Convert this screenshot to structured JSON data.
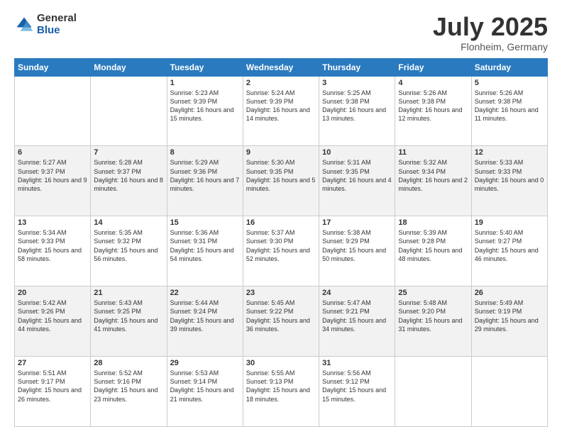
{
  "logo": {
    "general": "General",
    "blue": "Blue"
  },
  "title": "July 2025",
  "location": "Flonheim, Germany",
  "days_of_week": [
    "Sunday",
    "Monday",
    "Tuesday",
    "Wednesday",
    "Thursday",
    "Friday",
    "Saturday"
  ],
  "weeks": [
    [
      {
        "day": "",
        "sunrise": "",
        "sunset": "",
        "daylight": ""
      },
      {
        "day": "",
        "sunrise": "",
        "sunset": "",
        "daylight": ""
      },
      {
        "day": "1",
        "sunrise": "Sunrise: 5:23 AM",
        "sunset": "Sunset: 9:39 PM",
        "daylight": "Daylight: 16 hours and 15 minutes."
      },
      {
        "day": "2",
        "sunrise": "Sunrise: 5:24 AM",
        "sunset": "Sunset: 9:39 PM",
        "daylight": "Daylight: 16 hours and 14 minutes."
      },
      {
        "day": "3",
        "sunrise": "Sunrise: 5:25 AM",
        "sunset": "Sunset: 9:38 PM",
        "daylight": "Daylight: 16 hours and 13 minutes."
      },
      {
        "day": "4",
        "sunrise": "Sunrise: 5:26 AM",
        "sunset": "Sunset: 9:38 PM",
        "daylight": "Daylight: 16 hours and 12 minutes."
      },
      {
        "day": "5",
        "sunrise": "Sunrise: 5:26 AM",
        "sunset": "Sunset: 9:38 PM",
        "daylight": "Daylight: 16 hours and 11 minutes."
      }
    ],
    [
      {
        "day": "6",
        "sunrise": "Sunrise: 5:27 AM",
        "sunset": "Sunset: 9:37 PM",
        "daylight": "Daylight: 16 hours and 9 minutes."
      },
      {
        "day": "7",
        "sunrise": "Sunrise: 5:28 AM",
        "sunset": "Sunset: 9:37 PM",
        "daylight": "Daylight: 16 hours and 8 minutes."
      },
      {
        "day": "8",
        "sunrise": "Sunrise: 5:29 AM",
        "sunset": "Sunset: 9:36 PM",
        "daylight": "Daylight: 16 hours and 7 minutes."
      },
      {
        "day": "9",
        "sunrise": "Sunrise: 5:30 AM",
        "sunset": "Sunset: 9:35 PM",
        "daylight": "Daylight: 16 hours and 5 minutes."
      },
      {
        "day": "10",
        "sunrise": "Sunrise: 5:31 AM",
        "sunset": "Sunset: 9:35 PM",
        "daylight": "Daylight: 16 hours and 4 minutes."
      },
      {
        "day": "11",
        "sunrise": "Sunrise: 5:32 AM",
        "sunset": "Sunset: 9:34 PM",
        "daylight": "Daylight: 16 hours and 2 minutes."
      },
      {
        "day": "12",
        "sunrise": "Sunrise: 5:33 AM",
        "sunset": "Sunset: 9:33 PM",
        "daylight": "Daylight: 16 hours and 0 minutes."
      }
    ],
    [
      {
        "day": "13",
        "sunrise": "Sunrise: 5:34 AM",
        "sunset": "Sunset: 9:33 PM",
        "daylight": "Daylight: 15 hours and 58 minutes."
      },
      {
        "day": "14",
        "sunrise": "Sunrise: 5:35 AM",
        "sunset": "Sunset: 9:32 PM",
        "daylight": "Daylight: 15 hours and 56 minutes."
      },
      {
        "day": "15",
        "sunrise": "Sunrise: 5:36 AM",
        "sunset": "Sunset: 9:31 PM",
        "daylight": "Daylight: 15 hours and 54 minutes."
      },
      {
        "day": "16",
        "sunrise": "Sunrise: 5:37 AM",
        "sunset": "Sunset: 9:30 PM",
        "daylight": "Daylight: 15 hours and 52 minutes."
      },
      {
        "day": "17",
        "sunrise": "Sunrise: 5:38 AM",
        "sunset": "Sunset: 9:29 PM",
        "daylight": "Daylight: 15 hours and 50 minutes."
      },
      {
        "day": "18",
        "sunrise": "Sunrise: 5:39 AM",
        "sunset": "Sunset: 9:28 PM",
        "daylight": "Daylight: 15 hours and 48 minutes."
      },
      {
        "day": "19",
        "sunrise": "Sunrise: 5:40 AM",
        "sunset": "Sunset: 9:27 PM",
        "daylight": "Daylight: 15 hours and 46 minutes."
      }
    ],
    [
      {
        "day": "20",
        "sunrise": "Sunrise: 5:42 AM",
        "sunset": "Sunset: 9:26 PM",
        "daylight": "Daylight: 15 hours and 44 minutes."
      },
      {
        "day": "21",
        "sunrise": "Sunrise: 5:43 AM",
        "sunset": "Sunset: 9:25 PM",
        "daylight": "Daylight: 15 hours and 41 minutes."
      },
      {
        "day": "22",
        "sunrise": "Sunrise: 5:44 AM",
        "sunset": "Sunset: 9:24 PM",
        "daylight": "Daylight: 15 hours and 39 minutes."
      },
      {
        "day": "23",
        "sunrise": "Sunrise: 5:45 AM",
        "sunset": "Sunset: 9:22 PM",
        "daylight": "Daylight: 15 hours and 36 minutes."
      },
      {
        "day": "24",
        "sunrise": "Sunrise: 5:47 AM",
        "sunset": "Sunset: 9:21 PM",
        "daylight": "Daylight: 15 hours and 34 minutes."
      },
      {
        "day": "25",
        "sunrise": "Sunrise: 5:48 AM",
        "sunset": "Sunset: 9:20 PM",
        "daylight": "Daylight: 15 hours and 31 minutes."
      },
      {
        "day": "26",
        "sunrise": "Sunrise: 5:49 AM",
        "sunset": "Sunset: 9:19 PM",
        "daylight": "Daylight: 15 hours and 29 minutes."
      }
    ],
    [
      {
        "day": "27",
        "sunrise": "Sunrise: 5:51 AM",
        "sunset": "Sunset: 9:17 PM",
        "daylight": "Daylight: 15 hours and 26 minutes."
      },
      {
        "day": "28",
        "sunrise": "Sunrise: 5:52 AM",
        "sunset": "Sunset: 9:16 PM",
        "daylight": "Daylight: 15 hours and 23 minutes."
      },
      {
        "day": "29",
        "sunrise": "Sunrise: 5:53 AM",
        "sunset": "Sunset: 9:14 PM",
        "daylight": "Daylight: 15 hours and 21 minutes."
      },
      {
        "day": "30",
        "sunrise": "Sunrise: 5:55 AM",
        "sunset": "Sunset: 9:13 PM",
        "daylight": "Daylight: 15 hours and 18 minutes."
      },
      {
        "day": "31",
        "sunrise": "Sunrise: 5:56 AM",
        "sunset": "Sunset: 9:12 PM",
        "daylight": "Daylight: 15 hours and 15 minutes."
      },
      {
        "day": "",
        "sunrise": "",
        "sunset": "",
        "daylight": ""
      },
      {
        "day": "",
        "sunrise": "",
        "sunset": "",
        "daylight": ""
      }
    ]
  ]
}
